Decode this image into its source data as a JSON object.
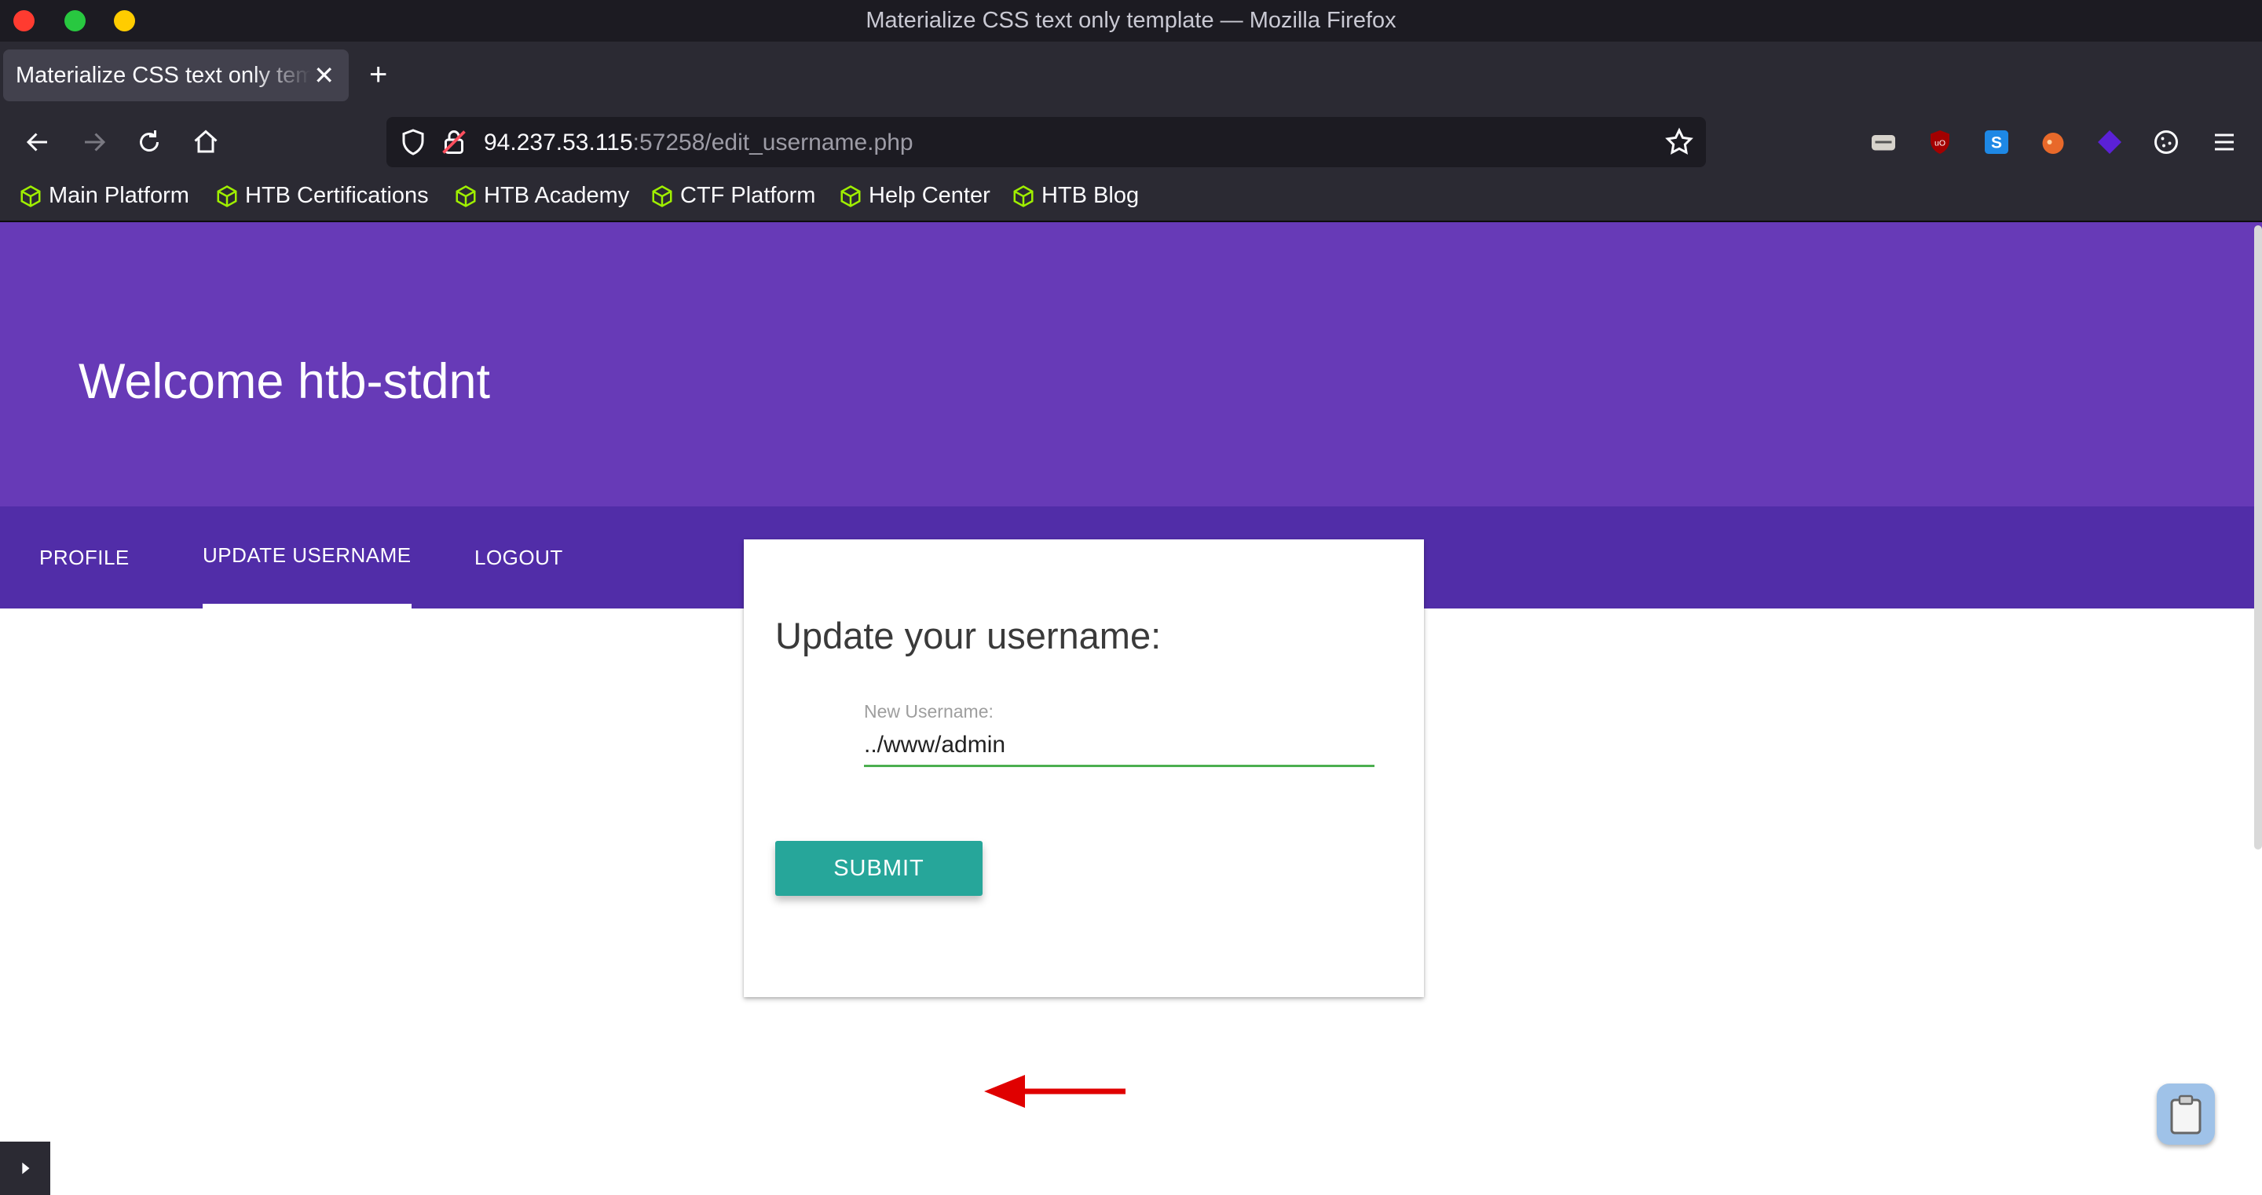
{
  "window": {
    "title": "Materialize CSS text only template — Mozilla Firefox"
  },
  "tabs": [
    {
      "title": "Materialize CSS text only template"
    }
  ],
  "urlbar": {
    "host": "94.237.53.115",
    "rest": ":57258/edit_username.php"
  },
  "bookmarks": [
    {
      "label": "Main Platform"
    },
    {
      "label": "HTB Certifications"
    },
    {
      "label": "HTB Academy"
    },
    {
      "label": "CTF Platform"
    },
    {
      "label": "Help Center"
    },
    {
      "label": "HTB Blog"
    }
  ],
  "extensions": [
    "foxyproxy-icon",
    "ublock-icon",
    "s-extension-icon",
    "fox-extension-icon",
    "wappalyzer-icon",
    "cookie-icon"
  ],
  "page": {
    "hero_title": "Welcome htb-stdnt",
    "nav": [
      {
        "label": "PROFILE"
      },
      {
        "label": "UPDATE USERNAME",
        "active": true
      },
      {
        "label": "LOGOUT"
      }
    ],
    "card": {
      "title": "Update your username:",
      "field_label": "New Username:",
      "field_value": "../www/admin",
      "submit_label": "SUBMIT"
    }
  },
  "colors": {
    "hero": "#673ab7",
    "nav": "#512da8",
    "submit": "#26a69a",
    "input_underline": "#4caf50",
    "annotation_arrow": "#e00000"
  }
}
